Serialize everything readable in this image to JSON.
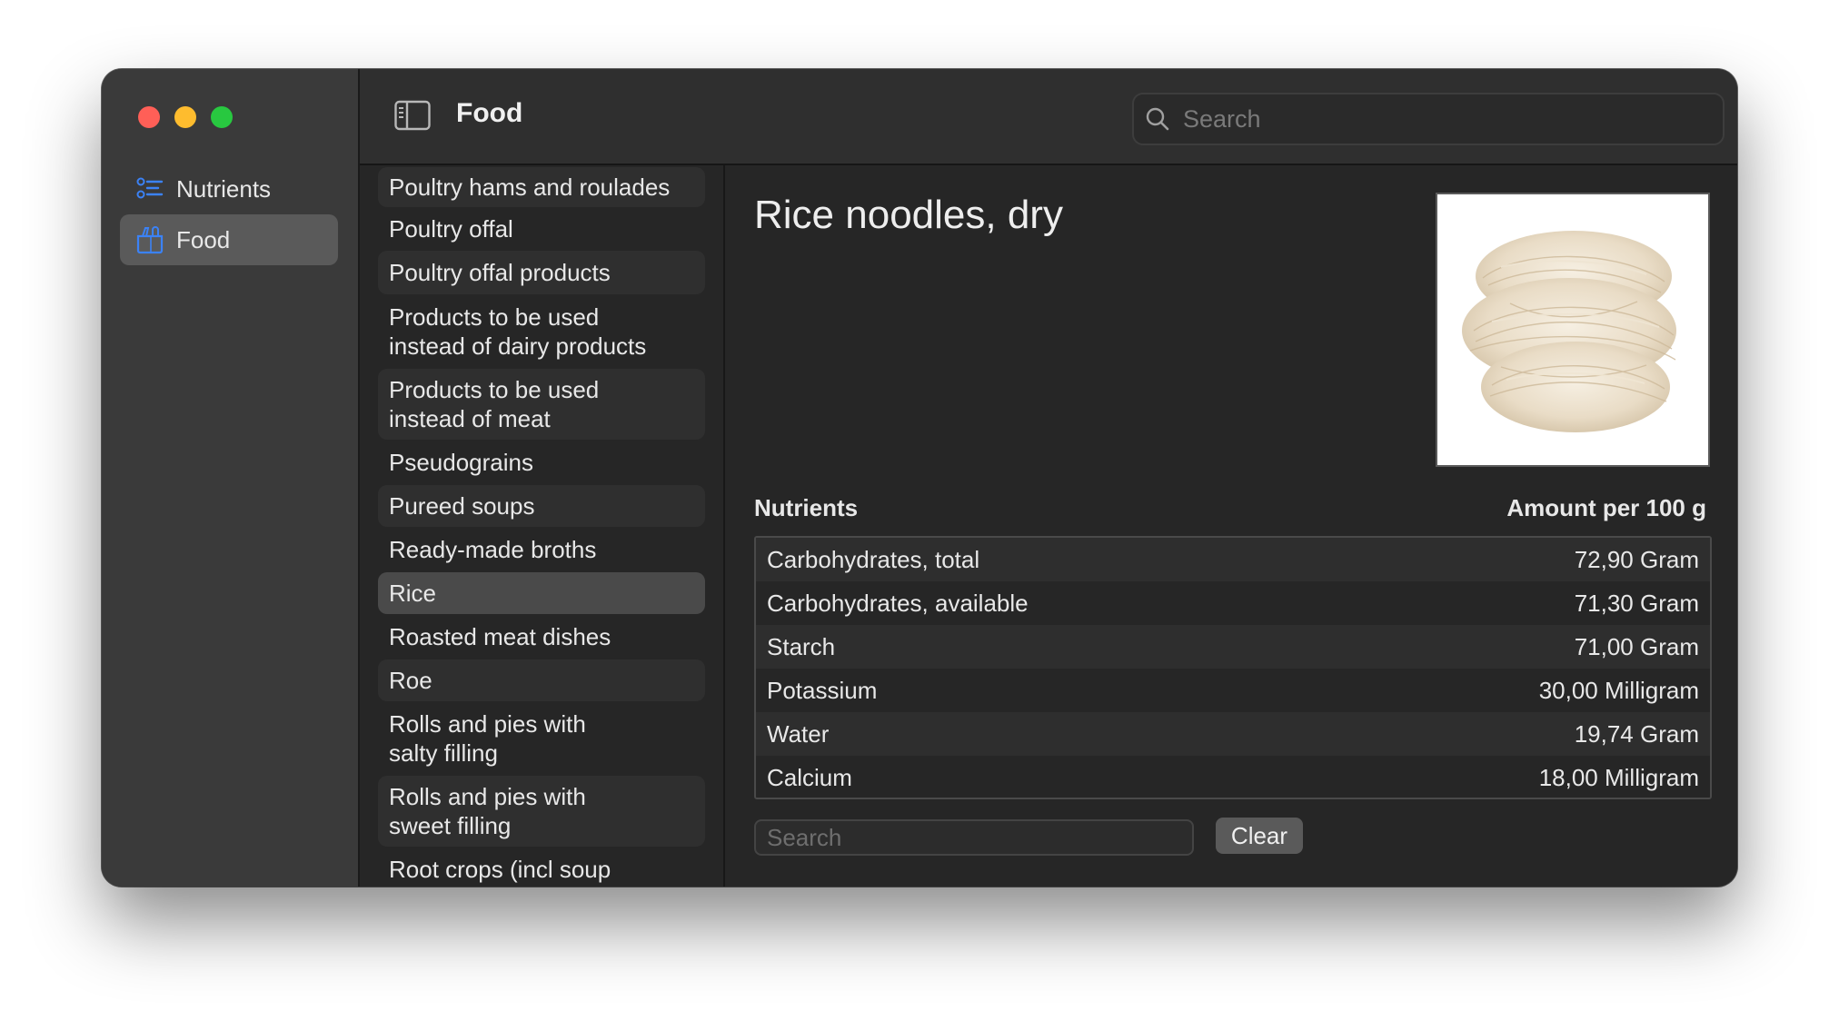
{
  "sidebar": {
    "items": [
      {
        "label": "Nutrients",
        "icon": "list-icon",
        "active": false
      },
      {
        "label": "Food",
        "icon": "food-basket-icon",
        "active": true
      }
    ],
    "accent": "#3b82f6"
  },
  "toolbar": {
    "title": "Food",
    "search_placeholder": "Search"
  },
  "categories": [
    {
      "label": "Poultry hams and roulades"
    },
    {
      "label": "Poultry offal"
    },
    {
      "label": "Poultry offal products"
    },
    {
      "label": "Products to be used instead of dairy products"
    },
    {
      "label": "Products to be used instead of meat"
    },
    {
      "label": "Pseudograins"
    },
    {
      "label": "Pureed soups"
    },
    {
      "label": "Ready-made broths"
    },
    {
      "label": "Rice",
      "selected": true
    },
    {
      "label": "Roasted meat dishes"
    },
    {
      "label": "Roe"
    },
    {
      "label": "Rolls and pies with salty filling"
    },
    {
      "label": "Rolls and pies with sweet filling"
    },
    {
      "label": "Root crops (incl soup"
    }
  ],
  "detail": {
    "title": "Rice noodles, dry",
    "nutrients_header": "Nutrients",
    "amount_header": "Amount per 100 g",
    "nutrients": [
      {
        "name": "Carbohydrates, total",
        "amount": "72,90 Gram"
      },
      {
        "name": "Carbohydrates, available",
        "amount": "71,30 Gram"
      },
      {
        "name": "Starch",
        "amount": "71,00 Gram"
      },
      {
        "name": "Potassium",
        "amount": "30,00 Milligram"
      },
      {
        "name": "Water",
        "amount": "19,74 Gram"
      },
      {
        "name": "Calcium",
        "amount": "18,00 Milligram"
      }
    ],
    "search_placeholder": "Search",
    "clear_label": "Clear"
  }
}
